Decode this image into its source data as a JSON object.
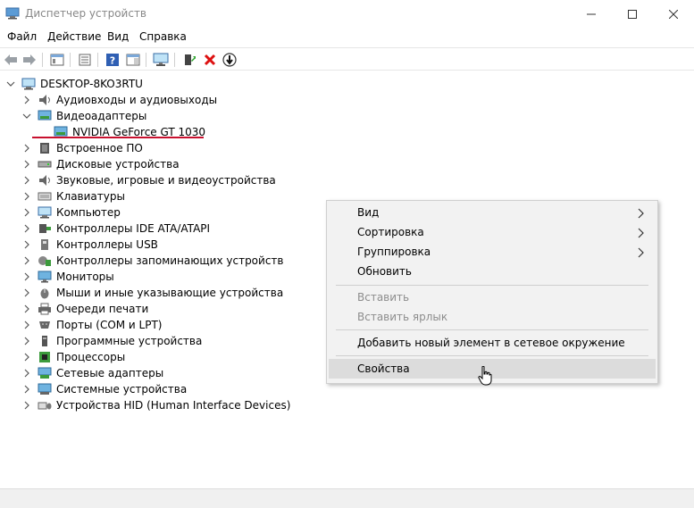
{
  "window": {
    "title": "Диспетчер устройств"
  },
  "menu": [
    "Файл",
    "Действие",
    "Вид",
    "Справка"
  ],
  "toolbar": {
    "icons": [
      "back-arrow-icon",
      "forward-arrow-icon",
      "show-hide-tree-icon",
      "properties-icon",
      "help-icon",
      "action-pane-icon",
      "monitor-icon",
      "update-driver-icon",
      "uninstall-device-icon",
      "disable-device-icon"
    ]
  },
  "tree": {
    "root": "DESKTOP-8KO3RTU",
    "items": [
      "Аудиовходы и аудиовыходы",
      "Видеоадаптеры",
      "NVIDIA GeForce GT 1030",
      "Встроенное ПО",
      "Дисковые устройства",
      "Звуковые, игровые и видеоустройства",
      "Клавиатуры",
      "Компьютер",
      "Контроллеры IDE ATA/ATAPI",
      "Контроллеры USB",
      "Контроллеры запоминающих устройств",
      "Мониторы",
      "Мыши и иные указывающие устройства",
      "Очереди печати",
      "Порты (COM и LPT)",
      "Программные устройства",
      "Процессоры",
      "Сетевые адаптеры",
      "Системные устройства",
      "Устройства HID (Human Interface Devices)"
    ]
  },
  "context_menu": {
    "items": [
      "Вид",
      "Сортировка",
      "Группировка",
      "Обновить",
      "Вставить",
      "Вставить ярлык",
      "Добавить новый элемент в сетевое окружение",
      "Свойства"
    ]
  },
  "colors": {
    "highlight_underline": "#c8102e",
    "menu_background": "#f2f2f2",
    "menu_hover": "#dcdcdc",
    "disabled_text": "#8d8d8d"
  }
}
